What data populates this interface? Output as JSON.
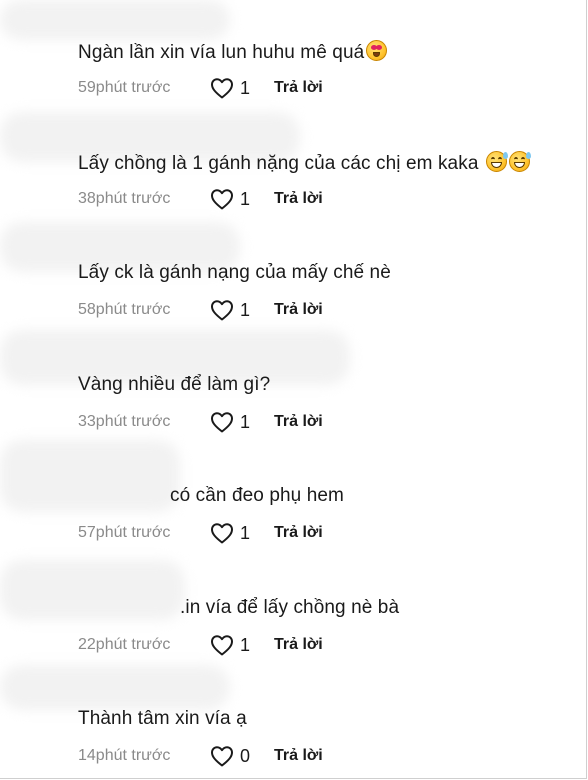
{
  "comments": [
    {
      "text": "Ngàn lần xin vía lun huhu mê quá",
      "emoji": "smiling-face-with-hearts",
      "time": "59phút trước",
      "likes": "1",
      "reply": "Trả lời"
    },
    {
      "text": "Lấy chồng là 1 gánh nặng của các chị em kaka",
      "emoji": "grinning-sweat-x2",
      "time": "38phút trước",
      "likes": "1",
      "reply": "Trả lời"
    },
    {
      "text": "Lấy ck là gánh nạng của mấy chế nè",
      "time": "58phút trước",
      "likes": "1",
      "reply": "Trả lời"
    },
    {
      "text": "Vàng nhiều để làm gì?",
      "time": "33phút trước",
      "likes": "1",
      "reply": "Trả lời"
    },
    {
      "text": "có cần đeo phụ hem",
      "time": "57phút trước",
      "likes": "1",
      "reply": "Trả lời"
    },
    {
      "text": ".in vía để lấy chồng nè bà",
      "time": "22phút trước",
      "likes": "1",
      "reply": "Trả lời"
    },
    {
      "text": "Thành tâm xin vía ạ",
      "time": "14phút trước",
      "likes": "0",
      "reply": "Trả lời"
    }
  ],
  "icons": {
    "like": "heart-outline-icon"
  },
  "colors": {
    "text": "#1a1a1a",
    "muted": "#8a8a8a",
    "background": "#ffffff"
  }
}
